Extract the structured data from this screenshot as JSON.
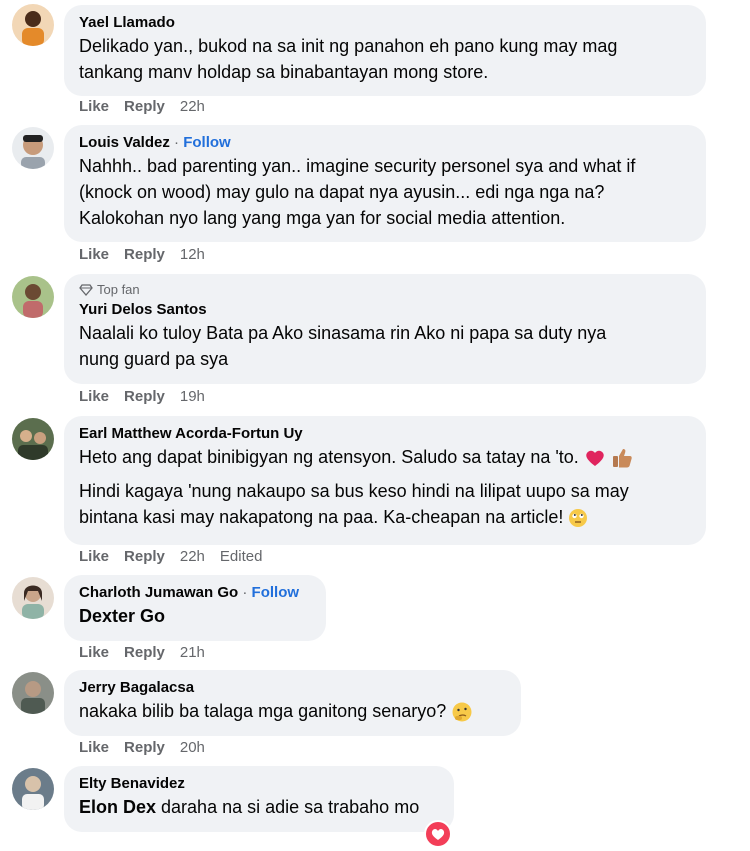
{
  "comments": [
    {
      "name": "Yael Llamado",
      "follow": "",
      "lines": [
        "Delikado yan., bukod na sa init ng panahon eh pano kung may mag",
        "tankang manv holdap sa binabantayan mong store."
      ],
      "like": "Like",
      "reply": "Reply",
      "time": "22h",
      "avatar_color": "#e48a2a"
    },
    {
      "name": "Louis Valdez",
      "follow": "Follow",
      "lines": [
        "Nahhh.. bad parenting yan.. imagine security personel sya and what if",
        "(knock on wood) may gulo na dapat nya ayusin... edi nga nga na?",
        "Kalokohan nyo lang yang mga yan for social media attention."
      ],
      "like": "Like",
      "reply": "Reply",
      "time": "12h",
      "avatar_color": "#d9c3b0"
    },
    {
      "badge": "Top fan",
      "name": "Yuri Delos Santos",
      "lines": [
        "Naalali ko tuloy Bata pa Ako sinasama rin Ako ni papa sa duty nya",
        "nung guard pa sya"
      ],
      "like": "Like",
      "reply": "Reply",
      "time": "19h",
      "avatar_color": "#9ab07a"
    },
    {
      "name": "Earl Matthew Acorda-Fortun Uy",
      "lines": [
        "Heto ang dapat binibigyan ng atensyon. Saludo sa tatay na 'to."
      ],
      "lines2": [
        "Hindi kagaya 'nung nakaupo sa bus keso hindi na lilipat uupo sa may",
        "bintana kasi may nakapatong na paa. Ka-cheapan na article!"
      ],
      "like": "Like",
      "reply": "Reply",
      "time": "22h",
      "edited": "Edited",
      "avatar_color": "#5b6e4e"
    },
    {
      "name": "Charloth Jumawan Go",
      "follow": "Follow",
      "tag": "Dexter Go",
      "like": "Like",
      "reply": "Reply",
      "time": "21h",
      "avatar_color": "#c9b7a8"
    },
    {
      "name": "Jerry Bagalacsa",
      "lines": [
        "nakaka bilib ba talaga mga ganitong senaryo?"
      ],
      "like": "Like",
      "reply": "Reply",
      "time": "20h",
      "avatar_color": "#8a8f88"
    },
    {
      "name": "Elty Benavidez",
      "tag": "Elon Dex",
      "rest": " daraha na si adie sa trabaho mo",
      "avatar_color": "#6b7c8a"
    }
  ],
  "colors": {
    "bubble": "#f0f2f5",
    "follow": "#216fdb",
    "meta": "#65676b"
  }
}
